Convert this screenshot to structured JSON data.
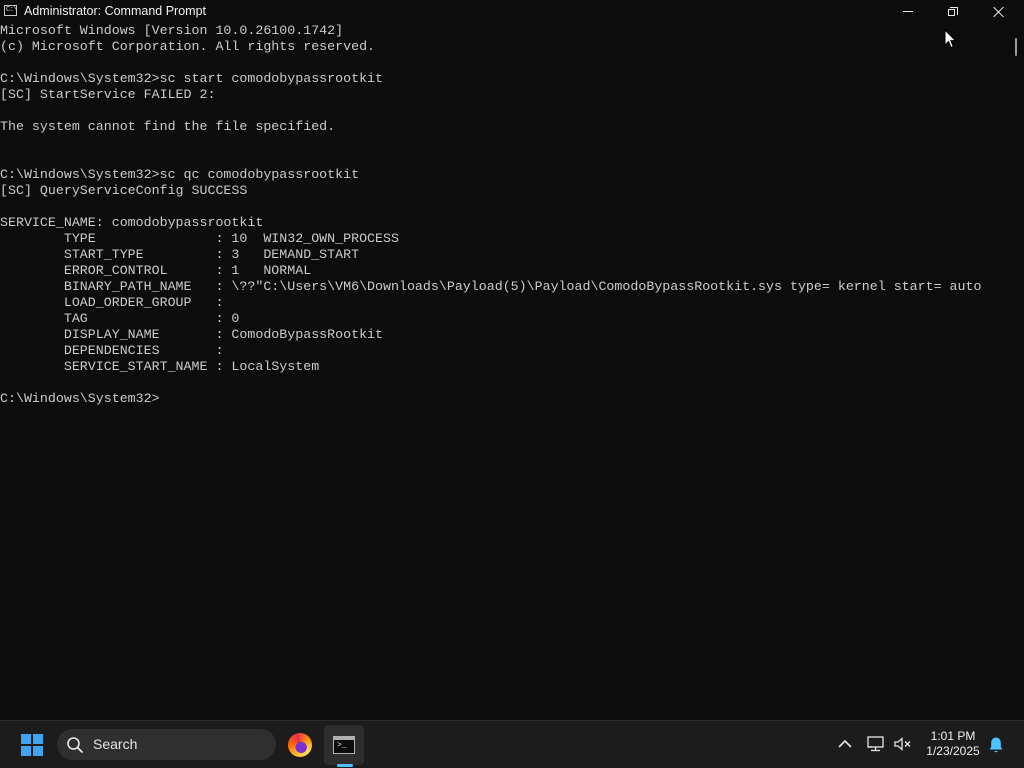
{
  "window": {
    "title": "Administrator: Command Prompt",
    "icon_text": "C:\\",
    "buttons": {
      "minimize": "minimize-icon",
      "maximize": "restore-icon",
      "close": "close-icon"
    }
  },
  "console": {
    "lines": [
      "Microsoft Windows [Version 10.0.26100.1742]",
      "(c) Microsoft Corporation. All rights reserved.",
      "",
      "C:\\Windows\\System32>sc start comodobypassrootkit",
      "[SC] StartService FAILED 2:",
      "",
      "The system cannot find the file specified.",
      "",
      "",
      "C:\\Windows\\System32>sc qc comodobypassrootkit",
      "[SC] QueryServiceConfig SUCCESS",
      "",
      "SERVICE_NAME: comodobypassrootkit",
      "        TYPE               : 10  WIN32_OWN_PROCESS",
      "        START_TYPE         : 3   DEMAND_START",
      "        ERROR_CONTROL      : 1   NORMAL",
      "        BINARY_PATH_NAME   : \\??\"C:\\Users\\VM6\\Downloads\\Payload(5)\\Payload\\ComodoBypassRootkit.sys type= kernel start= auto",
      "        LOAD_ORDER_GROUP   :",
      "        TAG                : 0",
      "        DISPLAY_NAME       : ComodoBypassRootkit",
      "        DEPENDENCIES       :",
      "        SERVICE_START_NAME : LocalSystem",
      "",
      "C:\\Windows\\System32>"
    ],
    "text_color": "#cccccc",
    "background": "#0c0c0c"
  },
  "taskbar": {
    "search_label": "Search",
    "apps": [
      {
        "name": "Firefox",
        "icon": "firefox-icon"
      },
      {
        "name": "Command Prompt",
        "icon": "terminal-icon",
        "active": true
      }
    ],
    "tray": {
      "chevron": "chevron-up-icon",
      "network": "network-icon",
      "volume": "volume-muted-icon",
      "notifications": "bell-icon"
    },
    "clock": {
      "time": "1:01 PM",
      "date": "1/23/2025"
    },
    "accent": "#4cc2ff",
    "start_color": "#3fa3ef"
  }
}
